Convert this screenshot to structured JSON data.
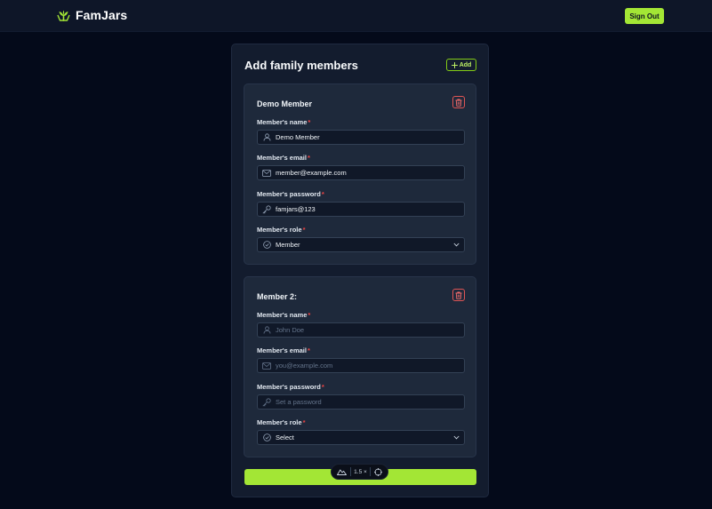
{
  "header": {
    "brand": "FamJars",
    "sign_out_label": "Sign Out",
    "brand_color": "#a3e635"
  },
  "form": {
    "title": "Add family members",
    "add_label": "Add",
    "members": [
      {
        "title": "Demo Member",
        "fields": {
          "name_label": "Member's name",
          "name_value": "Demo Member",
          "email_label": "Member's email",
          "email_value": "member@example.com",
          "password_label": "Member's password",
          "password_value": "famjars@123",
          "role_label": "Member's role",
          "role_value": "Member"
        }
      },
      {
        "title": "Member 2:",
        "fields": {
          "name_label": "Member's name",
          "name_placeholder": "John Doe",
          "email_label": "Member's email",
          "email_placeholder": "you@example.com",
          "password_label": "Member's password",
          "password_placeholder": "Set a password",
          "role_label": "Member's role",
          "role_value": "Select"
        }
      }
    ],
    "required_marker": "*"
  },
  "zoom": {
    "level": "1.5 ×"
  }
}
